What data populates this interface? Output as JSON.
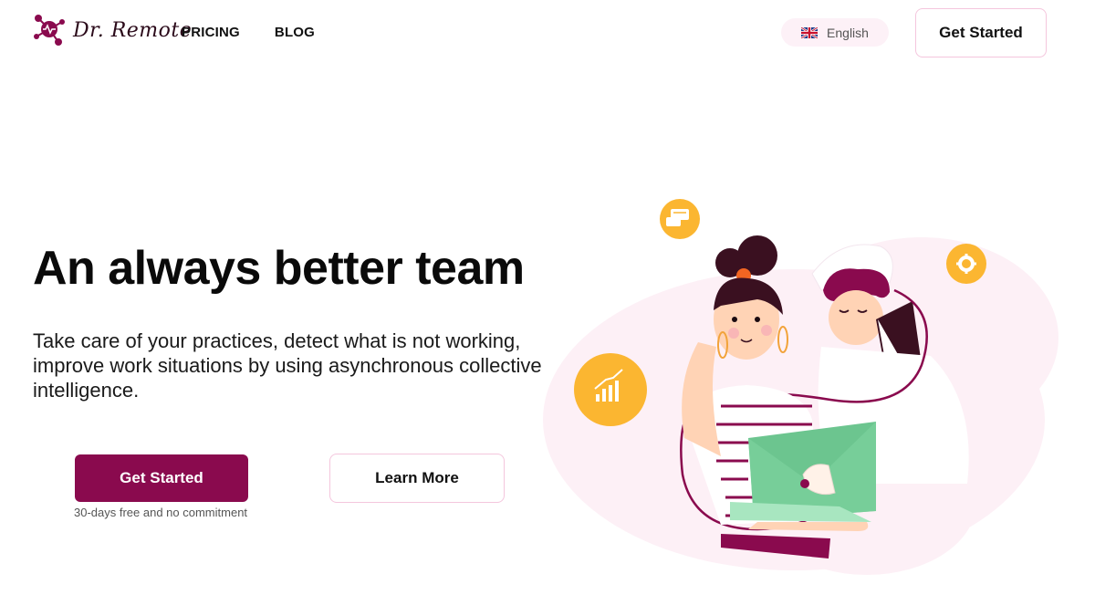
{
  "header": {
    "logo_text": "Dr. Remote",
    "nav": [
      {
        "label": "PRICING"
      },
      {
        "label": "BLOG"
      }
    ],
    "language": {
      "label": "English",
      "flag_icon": "uk-flag-icon"
    },
    "cta_label": "Get Started"
  },
  "hero": {
    "title": "An always better team",
    "description": "Take care of your practices, detect what is not working, improve work situations by using asynchronous collective intelligence.",
    "primary_cta": "Get Started",
    "primary_note": "30-days free and no commitment",
    "secondary_cta": "Learn More"
  },
  "illustration": {
    "icons": [
      "chat-bubble-icon",
      "gear-icon",
      "bar-chart-icon"
    ]
  },
  "colors": {
    "brand": "#8a0a4e",
    "accent_yellow": "#fbb631",
    "border_pink": "#f4c6dd",
    "blob_pink": "#fdf0f6"
  }
}
